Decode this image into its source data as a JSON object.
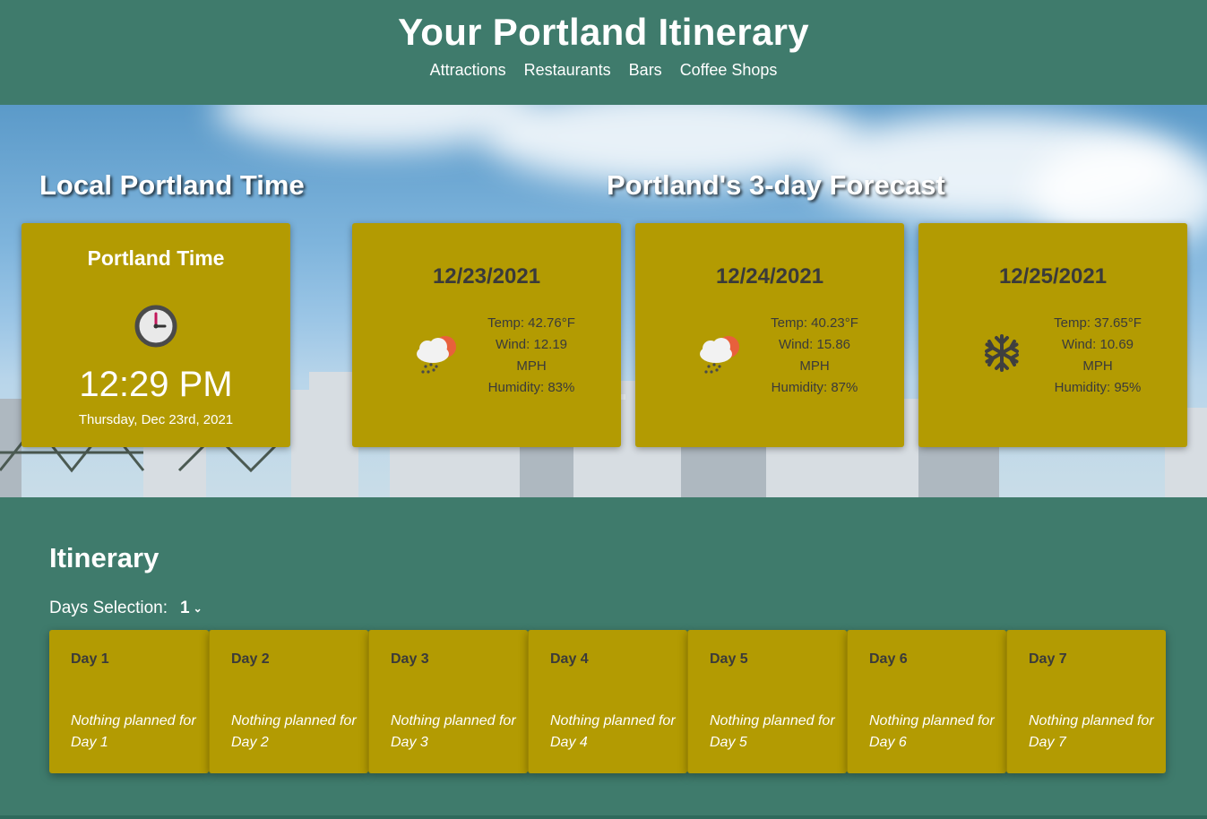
{
  "header": {
    "title": "Your Portland Itinerary",
    "nav": [
      "Attractions",
      "Restaurants",
      "Bars",
      "Coffee Shops"
    ]
  },
  "time_section": {
    "heading": "Local Portland Time",
    "card_title": "Portland Time",
    "icon": "clock-icon",
    "time": "12:29 PM",
    "date": "Thursday, Dec 23rd, 2021"
  },
  "forecast_section": {
    "heading": "Portland's 3-day Forecast",
    "days": [
      {
        "date": "12/23/2021",
        "icon": "rain-cloud-sun-icon",
        "temp": "Temp: 42.76°F",
        "wind": "Wind: 12.19",
        "wind_unit": "MPH",
        "humidity": "Humidity: 83%"
      },
      {
        "date": "12/24/2021",
        "icon": "rain-cloud-sun-icon",
        "temp": "Temp: 40.23°F",
        "wind": "Wind: 15.86",
        "wind_unit": "MPH",
        "humidity": "Humidity: 87%"
      },
      {
        "date": "12/25/2021",
        "icon": "snowflake-icon",
        "temp": "Temp: 37.65°F",
        "wind": "Wind: 10.69",
        "wind_unit": "MPH",
        "humidity": "Humidity: 95%"
      }
    ]
  },
  "itinerary": {
    "title": "Itinerary",
    "days_label": "Days Selection:",
    "days_selected": "1",
    "days": [
      {
        "title": "Day 1",
        "note": "Nothing planned for Day 1"
      },
      {
        "title": "Day 2",
        "note": "Nothing planned for Day 2"
      },
      {
        "title": "Day 3",
        "note": "Nothing planned for Day 3"
      },
      {
        "title": "Day 4",
        "note": "Nothing planned for Day 4"
      },
      {
        "title": "Day 5",
        "note": "Nothing planned for Day 5"
      },
      {
        "title": "Day 6",
        "note": "Nothing planned for Day 6"
      },
      {
        "title": "Day 7",
        "note": "Nothing planned for Day 7"
      }
    ]
  },
  "colors": {
    "primary": "#3f7b6c",
    "card": "#b39b02",
    "text_dark": "#3a3a3a"
  }
}
